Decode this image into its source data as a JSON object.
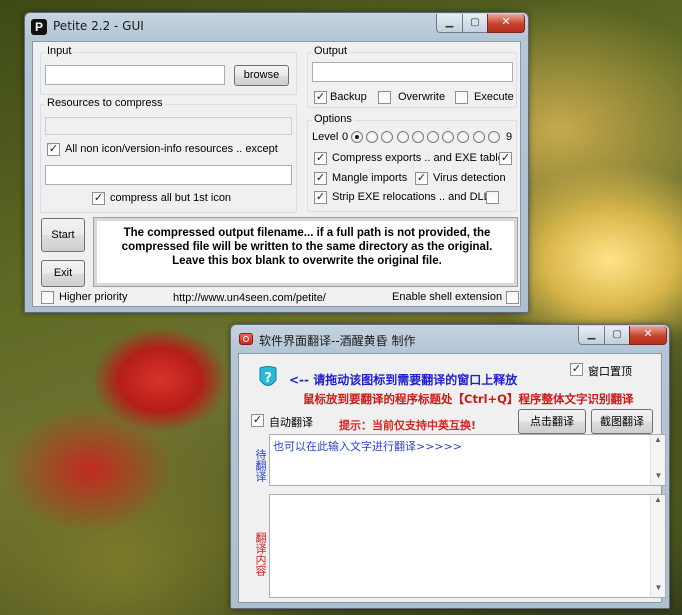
{
  "petite": {
    "title": "Petite 2.2 - GUI",
    "app_icon_glyph": "P",
    "input_label": "Input",
    "browse_label": "browse",
    "output_label": "Output",
    "backup_label": "Backup",
    "backup_checked": true,
    "overwrite_label": "Overwrite",
    "overwrite_checked": false,
    "execute_label": "Execute",
    "execute_checked": false,
    "resources_label": "Resources to compress",
    "all_resources_label": "All non icon/version-info resources .. except",
    "all_resources_checked": true,
    "compress_icon_label": "compress all but 1st icon",
    "compress_icon_checked": true,
    "options_label": "Options",
    "level_label": "Level",
    "level_min": "0",
    "level_max": "9",
    "level_selected": 0,
    "compress_exports_label": "Compress exports .. and EXE table",
    "compress_exports_checked": true,
    "exe_table_checked": true,
    "mangle_imports_label": "Mangle imports",
    "mangle_imports_checked": true,
    "virus_detection_label": "Virus detection",
    "virus_detection_checked": true,
    "strip_relocations_label": "Strip EXE relocations .. and DLL",
    "strip_relocations_checked": true,
    "dll_checked": false,
    "start_label": "Start",
    "exit_label": "Exit",
    "help_text": "The compressed output filename... if a full path is not provided, the compressed file will be written to the same directory as the original. Leave this box blank to overwrite the original file.",
    "high_priority_label": "Higher priority",
    "high_priority_checked": false,
    "url": "http://www.un4seen.com/petite/",
    "shell_ext_label": "Enable shell extension",
    "shell_ext_checked": false
  },
  "translator": {
    "title": "软件界面翻译--酒醒黄昏 制作",
    "top_checkbox_label": "窗口置顶",
    "top_checked": true,
    "instruction_1": "<-- 请拖动该图标到需要翻译的窗口上释放",
    "instruction_2": "鼠标放到要翻译的程序标题处【Ctrl+Q】程序整体文字识别翻译",
    "auto_translate_label": "自动翻译",
    "auto_checked": true,
    "hint": "提示：当前仅支持中英互换!",
    "click_translate_label": "点击翻译",
    "screenshot_translate_label": "截图翻译",
    "source_side_label": "待翻译",
    "source_text": "也可以在此输入文字进行翻译>>>>>",
    "result_side_label": "翻译内容",
    "result_text": ""
  },
  "colors": {
    "instruction_blue": "#1f1fd0",
    "instruction_red": "#d01818",
    "hint_red": "#e02020",
    "side_label_blue": "#2a3fd8",
    "side_label_red": "#d82020"
  },
  "icons": {
    "drag_target": "question-mark-drop-icon",
    "window_icon": "translator-app-icon"
  }
}
